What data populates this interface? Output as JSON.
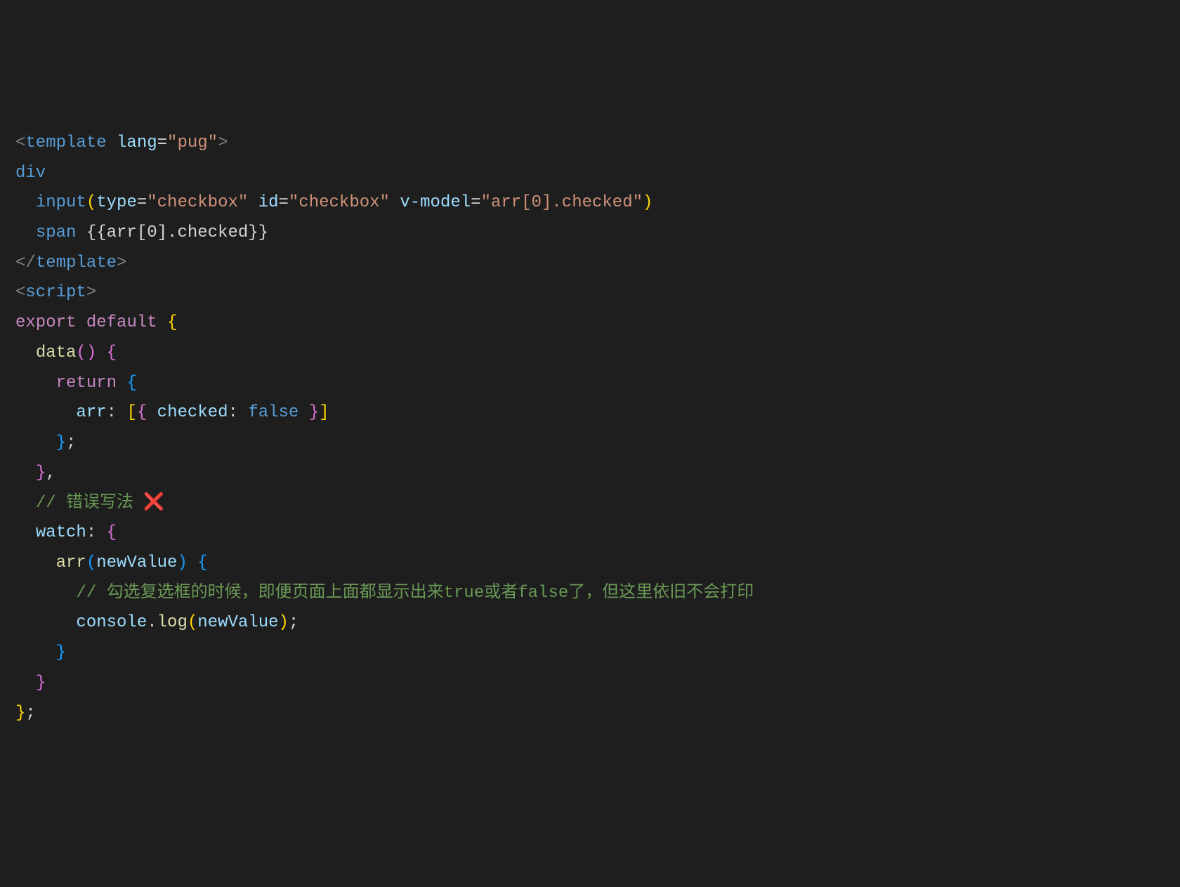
{
  "lines": {
    "l1": {
      "open_bracket": "<",
      "tag": "template",
      "attr_name": "lang",
      "eq": "=",
      "attr_val": "\"pug\"",
      "close_bracket": ">"
    },
    "l2": {
      "tag": "div"
    },
    "l3": {
      "tag": "input",
      "paren_open": "(",
      "attr1_name": "type",
      "attr1_val": "\"checkbox\"",
      "attr2_name": "id",
      "attr2_val": "\"checkbox\"",
      "attr3_name": "v-model",
      "attr3_val": "\"arr[0].checked\"",
      "paren_close": ")",
      "eq": "="
    },
    "l4": {
      "tag": "span",
      "text": " {{arr[0].checked}}"
    },
    "l5": {
      "open": "</",
      "tag": "template",
      "close": ">"
    },
    "l6": {
      "open": "<",
      "tag": "script",
      "close": ">"
    },
    "l7": {
      "kw1": "export",
      "kw2": "default",
      "brace": "{"
    },
    "l8": {
      "method": "data",
      "paren_open": "(",
      "paren_close": ")",
      "brace": "{"
    },
    "l9": {
      "kw": "return",
      "brace": "{"
    },
    "l10": {
      "prop": "arr",
      "colon": ":",
      "bracket_open": "[",
      "brace_open": "{",
      "prop2": "checked",
      "colon2": ":",
      "bool": "false",
      "brace_close": "}",
      "bracket_close": "]"
    },
    "l11": {
      "brace": "}",
      "semi": ";"
    },
    "l12": {
      "brace": "}",
      "comma": ","
    },
    "l13": {
      "comment": "// 错误写法 ",
      "cross": "❌"
    },
    "l14": {
      "prop": "watch",
      "colon": ":",
      "brace": "{"
    },
    "l15": {
      "method": "arr",
      "paren_open": "(",
      "param": "newValue",
      "paren_close": ")",
      "brace": "{"
    },
    "l16": {
      "comment": "// 勾选复选框的时候，即便页面上面都显示出来true或者false了，但这里依旧不会打印"
    },
    "l17": {
      "obj": "console",
      "dot": ".",
      "method": "log",
      "paren_open": "(",
      "param": "newValue",
      "paren_close": ")",
      "semi": ";"
    },
    "l18": {
      "brace": "}"
    },
    "l19": {
      "brace": "}"
    },
    "l20": {
      "brace": "}",
      "semi": ";"
    }
  }
}
